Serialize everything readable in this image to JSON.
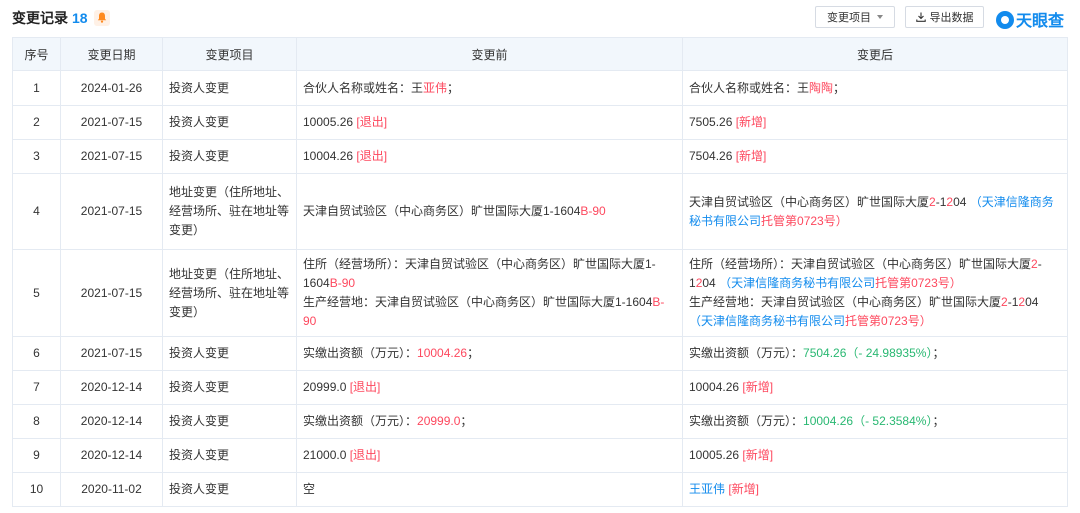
{
  "header": {
    "title": "变更记录",
    "count": "18",
    "filter_label": "变更项目",
    "export_label": "导出数据",
    "logo_text": "天眼查"
  },
  "table": {
    "columns": [
      "序号",
      "变更日期",
      "变更项目",
      "变更前",
      "变更后"
    ],
    "rows": [
      {
        "index": "1",
        "date": "2024-01-26",
        "item": "投资人变更",
        "before": [
          [
            {
              "t": "合伙人名称或姓名：王"
            },
            {
              "t": "亚伟",
              "c": "red"
            },
            {
              "t": "；"
            }
          ]
        ],
        "after": [
          [
            {
              "t": "合伙人名称或姓名：王"
            },
            {
              "t": "陶陶",
              "c": "red"
            },
            {
              "t": "；"
            }
          ]
        ]
      },
      {
        "index": "2",
        "date": "2021-07-15",
        "item": "投资人变更",
        "before": [
          [
            {
              "t": "10005.26 "
            },
            {
              "t": "[退出]",
              "c": "red"
            }
          ]
        ],
        "after": [
          [
            {
              "t": "7505.26 "
            },
            {
              "t": "[新增]",
              "c": "red"
            }
          ]
        ]
      },
      {
        "index": "3",
        "date": "2021-07-15",
        "item": "投资人变更",
        "before": [
          [
            {
              "t": "10004.26 "
            },
            {
              "t": "[退出]",
              "c": "red"
            }
          ]
        ],
        "after": [
          [
            {
              "t": "7504.26 "
            },
            {
              "t": "[新增]",
              "c": "red"
            }
          ]
        ]
      },
      {
        "index": "4",
        "date": "2021-07-15",
        "item": "地址变更（住所地址、经营场所、驻在地址等变更）",
        "before": [
          [
            {
              "t": "天津自贸试验区（中心商务区）旷世国际大厦1-1604"
            },
            {
              "t": "B-90",
              "c": "red"
            }
          ]
        ],
        "after": [
          [
            {
              "t": "天津自贸试验区（中心商务区）旷世国际大厦"
            },
            {
              "t": "2",
              "c": "red"
            },
            {
              "t": "-1"
            },
            {
              "t": "2",
              "c": "red"
            },
            {
              "t": "04 "
            },
            {
              "t": "（天津信隆商务秘书有限公司",
              "c": "blue"
            },
            {
              "t": "托管第0723号）",
              "c": "red"
            }
          ]
        ]
      },
      {
        "index": "5",
        "date": "2021-07-15",
        "item": "地址变更（住所地址、经营场所、驻在地址等变更）",
        "before": [
          [
            {
              "t": "住所（经营场所）：天津自贸试验区（中心商务区）旷世国际大厦1-1604"
            },
            {
              "t": "B-90",
              "c": "red"
            }
          ],
          [
            {
              "t": "生产经营地：天津自贸试验区（中心商务区）旷世国际大厦1-1604"
            },
            {
              "t": "B-90",
              "c": "red"
            }
          ]
        ],
        "after": [
          [
            {
              "t": "住所（经营场所）：天津自贸试验区（中心商务区）旷世国际大厦"
            },
            {
              "t": "2",
              "c": "red"
            },
            {
              "t": "-1"
            },
            {
              "t": "2",
              "c": "red"
            },
            {
              "t": "04 "
            },
            {
              "t": "（天津信隆商务秘书有限公司",
              "c": "blue"
            },
            {
              "t": "托管第0723号）",
              "c": "red"
            }
          ],
          [
            {
              "t": "生产经营地：天津自贸试验区（中心商务区）旷世国际大厦"
            },
            {
              "t": "2",
              "c": "red"
            },
            {
              "t": "-1"
            },
            {
              "t": "2",
              "c": "red"
            },
            {
              "t": "04 "
            },
            {
              "t": "（天津信隆商务秘书有限公司",
              "c": "blue"
            },
            {
              "t": "托管第0723号）",
              "c": "red"
            }
          ]
        ]
      },
      {
        "index": "6",
        "date": "2021-07-15",
        "item": "投资人变更",
        "before": [
          [
            {
              "t": "实缴出资额（万元）："
            },
            {
              "t": "10004.26",
              "c": "red"
            },
            {
              "t": "；"
            }
          ]
        ],
        "after": [
          [
            {
              "t": "实缴出资额（万元）："
            },
            {
              "t": "7504.26（- 24.98935%）",
              "c": "green"
            },
            {
              "t": "；"
            }
          ]
        ]
      },
      {
        "index": "7",
        "date": "2020-12-14",
        "item": "投资人变更",
        "before": [
          [
            {
              "t": "20999.0 "
            },
            {
              "t": "[退出]",
              "c": "red"
            }
          ]
        ],
        "after": [
          [
            {
              "t": "10004.26 "
            },
            {
              "t": "[新增]",
              "c": "red"
            }
          ]
        ]
      },
      {
        "index": "8",
        "date": "2020-12-14",
        "item": "投资人变更",
        "before": [
          [
            {
              "t": "实缴出资额（万元）："
            },
            {
              "t": "20999.0",
              "c": "red"
            },
            {
              "t": "；"
            }
          ]
        ],
        "after": [
          [
            {
              "t": "实缴出资额（万元）："
            },
            {
              "t": "10004.26（- 52.3584%）",
              "c": "green"
            },
            {
              "t": "；"
            }
          ]
        ]
      },
      {
        "index": "9",
        "date": "2020-12-14",
        "item": "投资人变更",
        "before": [
          [
            {
              "t": "21000.0 "
            },
            {
              "t": "[退出]",
              "c": "red"
            }
          ]
        ],
        "after": [
          [
            {
              "t": "10005.26 "
            },
            {
              "t": "[新增]",
              "c": "red"
            }
          ]
        ]
      },
      {
        "index": "10",
        "date": "2020-11-02",
        "item": "投资人变更",
        "before": [
          [
            {
              "t": "空"
            }
          ]
        ],
        "after": [
          [
            {
              "t": "王亚伟",
              "c": "blue"
            },
            {
              "t": " [新增]",
              "c": "red"
            }
          ]
        ]
      }
    ]
  },
  "colors": {
    "accent": "#128bed",
    "added_removed": "#fd485e",
    "decrease": "#29b872",
    "header_bg": "#f2f7fc",
    "border": "#e4eaf2"
  },
  "icons": [
    "bell-icon",
    "chevron-down-icon",
    "download-icon",
    "tianyancha-logo-icon"
  ]
}
